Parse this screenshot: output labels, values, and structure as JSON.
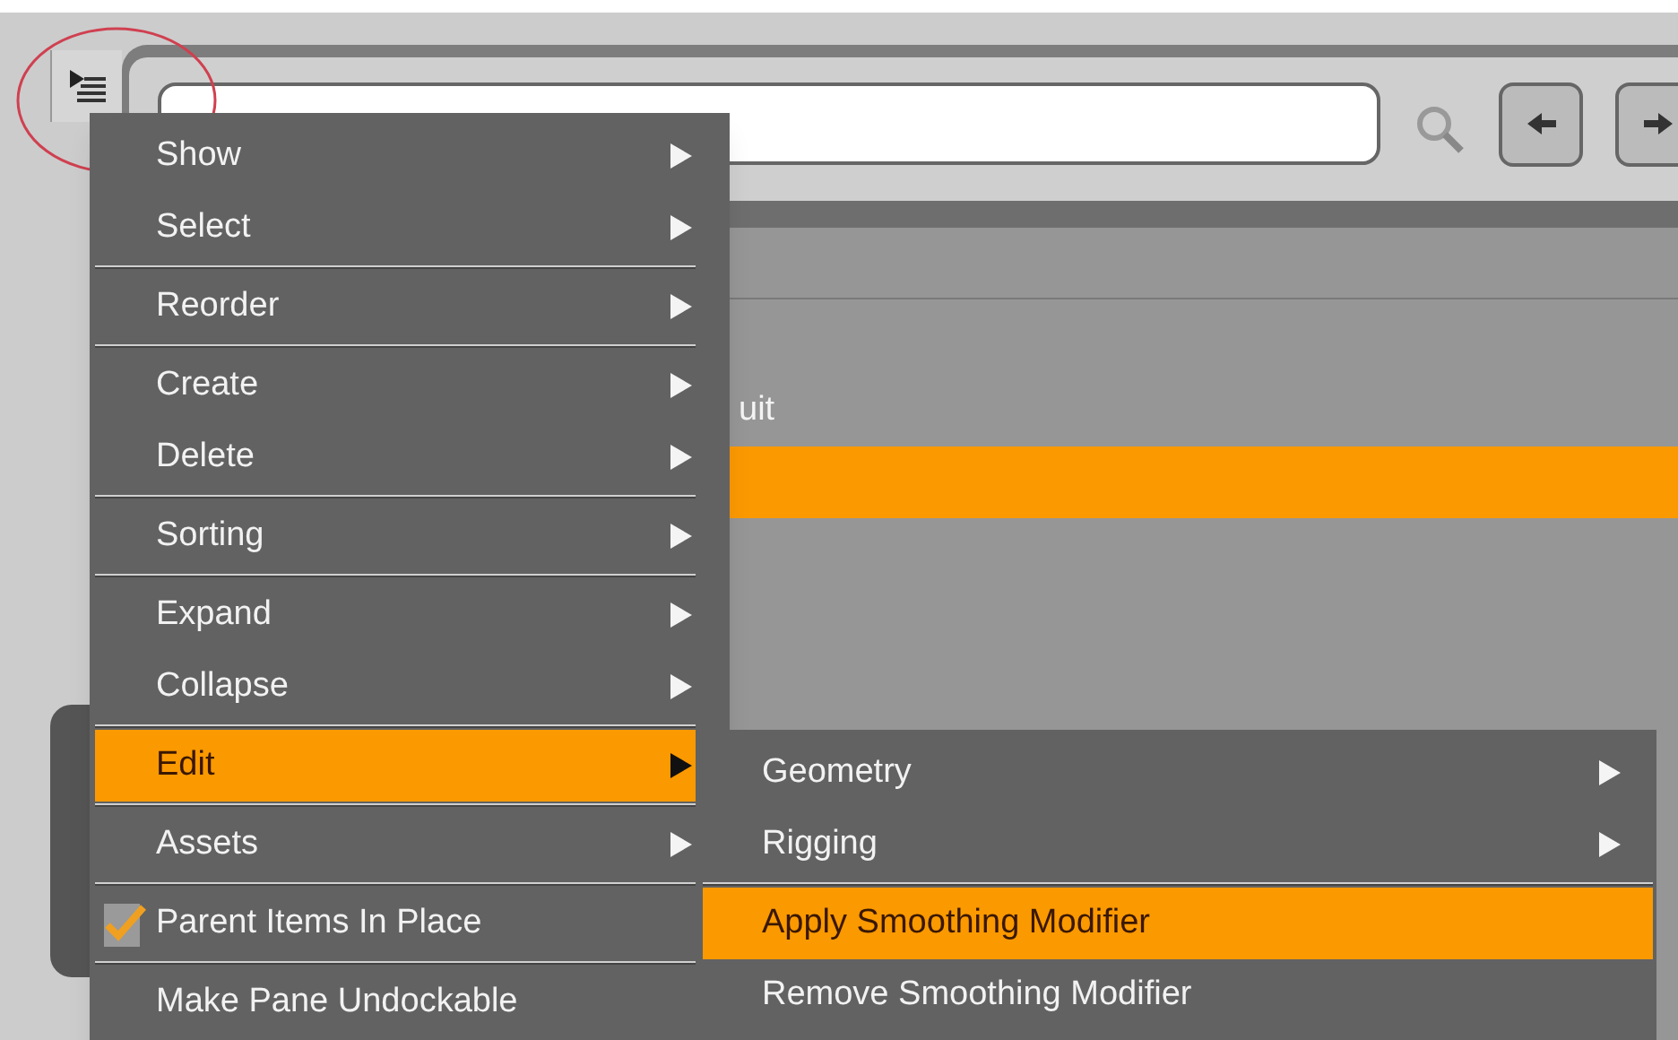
{
  "tree": {
    "rows": [
      {
        "text": "uit",
        "selected": false
      },
      {
        "selected": true
      }
    ]
  },
  "context_menu": {
    "items": [
      {
        "label": "Show",
        "kind": "submenu",
        "selected": false,
        "separator_before": false
      },
      {
        "label": "Select",
        "kind": "submenu",
        "selected": false,
        "separator_before": false
      },
      {
        "label": "Reorder",
        "kind": "submenu",
        "selected": false,
        "separator_before": true
      },
      {
        "label": "Create",
        "kind": "submenu",
        "selected": false,
        "separator_before": true
      },
      {
        "label": "Delete",
        "kind": "submenu",
        "selected": false,
        "separator_before": false
      },
      {
        "label": "Sorting",
        "kind": "submenu",
        "selected": false,
        "separator_before": true
      },
      {
        "label": "Expand",
        "kind": "submenu",
        "selected": false,
        "separator_before": true
      },
      {
        "label": "Collapse",
        "kind": "submenu",
        "selected": false,
        "separator_before": false
      },
      {
        "label": "Edit",
        "kind": "submenu",
        "selected": true,
        "separator_before": true
      },
      {
        "label": "Assets",
        "kind": "submenu",
        "selected": false,
        "separator_before": true
      },
      {
        "label": "Parent Items In Place",
        "kind": "check",
        "checked": true,
        "selected": false,
        "separator_before": true
      },
      {
        "label": "Make Pane Undockable",
        "kind": "action",
        "selected": false,
        "separator_before": true
      }
    ]
  },
  "submenu": {
    "items": [
      {
        "label": "Geometry",
        "kind": "submenu",
        "selected": false,
        "separator_before": false
      },
      {
        "label": "Rigging",
        "kind": "submenu",
        "selected": false,
        "separator_before": false
      },
      {
        "label": "Apply Smoothing Modifier",
        "kind": "action",
        "selected": true,
        "separator_before": true
      },
      {
        "label": "Remove Smoothing Modifier",
        "kind": "action",
        "selected": false,
        "separator_before": false
      }
    ]
  }
}
